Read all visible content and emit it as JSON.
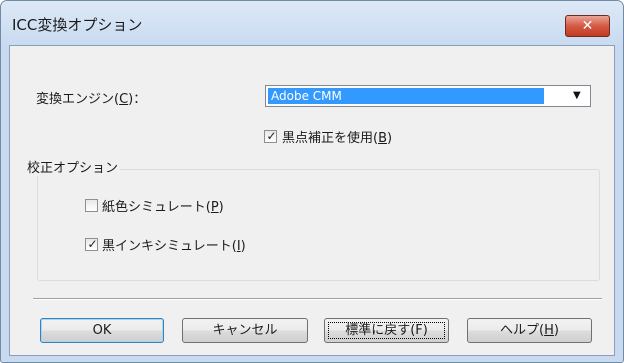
{
  "window": {
    "title": "ICC変換オプション",
    "close_glyph": "✕"
  },
  "engine": {
    "label": "変換エンジン(",
    "key": "C",
    "label_end": ")：",
    "value": "Adobe CMM",
    "arrow": "▼"
  },
  "black_point": {
    "label": "黒点補正を使用(",
    "key": "B",
    "label_end": ")",
    "checked": true
  },
  "proofing": {
    "title": "校正オプション",
    "paper": {
      "label": "紙色シミュレート(",
      "key": "P",
      "label_end": ")",
      "checked": false
    },
    "ink": {
      "label": "黒インキシミュレート(",
      "key": "I",
      "label_end": ")",
      "checked": true
    }
  },
  "buttons": {
    "ok": "OK",
    "cancel": "キャンセル",
    "reset": "標準に戻す(F)",
    "help_label": "ヘルプ(",
    "help_key": "H",
    "help_end": ")"
  },
  "check_glyph": "✓",
  "colors": {
    "accent": "#3399ff",
    "close": "#c23a22",
    "title_bar": "#c9daf0"
  }
}
